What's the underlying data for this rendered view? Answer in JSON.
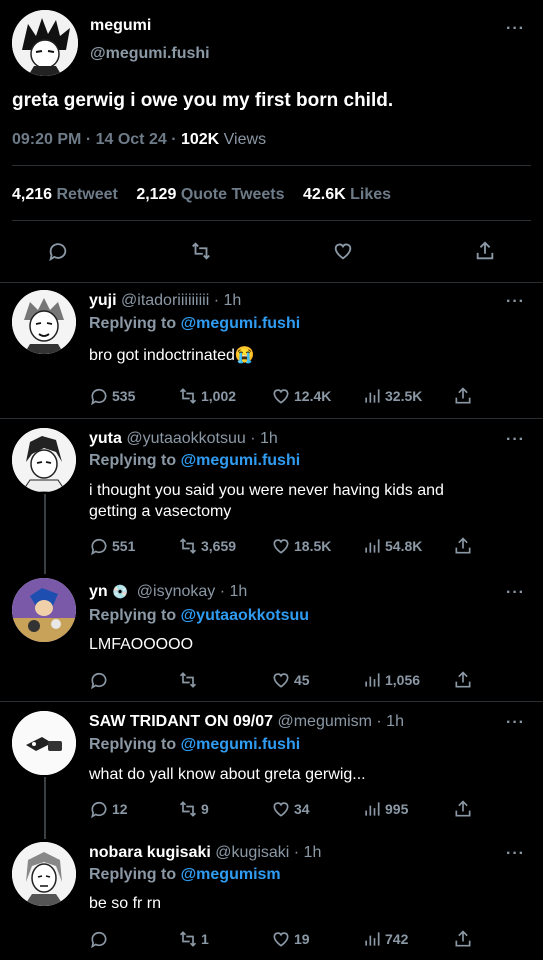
{
  "main_tweet": {
    "name": "megumi",
    "handle": "@megumi.fushi",
    "text": "greta gerwig i owe you my first born child.",
    "time": "09:20 PM · 14 Oct 24 ·",
    "views_count": "102K",
    "views_label": "Views",
    "retweets": "4,216",
    "retweets_label": "Retweet",
    "quotes": "2,129",
    "quotes_label": "Quote Tweets",
    "likes": "42.6K",
    "likes_label": "Likes",
    "more": "···"
  },
  "replies": [
    {
      "name": "yuji",
      "handle": "@itadoriiiiiiiii · 1h",
      "replying_prefix": "Replying to",
      "replying_to": "@megumi.fushi",
      "text": "bro got indoctrinated😭",
      "comments": "535",
      "retweets": "1,002",
      "likes": "12.4K",
      "views": "32.5K",
      "more": "···"
    },
    {
      "name": "yuta",
      "handle": "@yutaaokkotsuu · 1h",
      "replying_prefix": "Replying to",
      "replying_to": "@megumi.fushi",
      "text_line1": "i thought you said you were never having kids and",
      "text_line2": "getting a vasectomy",
      "comments": "551",
      "retweets": "3,659",
      "likes": "18.5K",
      "views": "54.8K",
      "more": "···"
    },
    {
      "name": "yn",
      "badge": "💿",
      "handle": "@isynokay · 1h",
      "replying_prefix": "Replying to",
      "replying_to": "@yutaaokkotsuu",
      "text": "LMFAOOOOO",
      "comments": "",
      "retweets": "",
      "likes": "45",
      "views": "1,056",
      "more": "···"
    },
    {
      "name": "SAW TRIDANT ON 09/07",
      "handle": "@megumism · 1h",
      "replying_prefix": "Replying to",
      "replying_to": "@megumi.fushi",
      "text": "what do yall know about greta gerwig...",
      "comments": "12",
      "retweets": "9",
      "likes": "34",
      "views": "995",
      "more": "···"
    },
    {
      "name": "nobara kugisaki",
      "handle": "@kugisaki · 1h",
      "replying_prefix": "Replying to",
      "replying_to": "@megumism",
      "text": "be so fr rn",
      "comments": "",
      "retweets": "1",
      "likes": "19",
      "views": "742",
      "more": "···"
    }
  ]
}
